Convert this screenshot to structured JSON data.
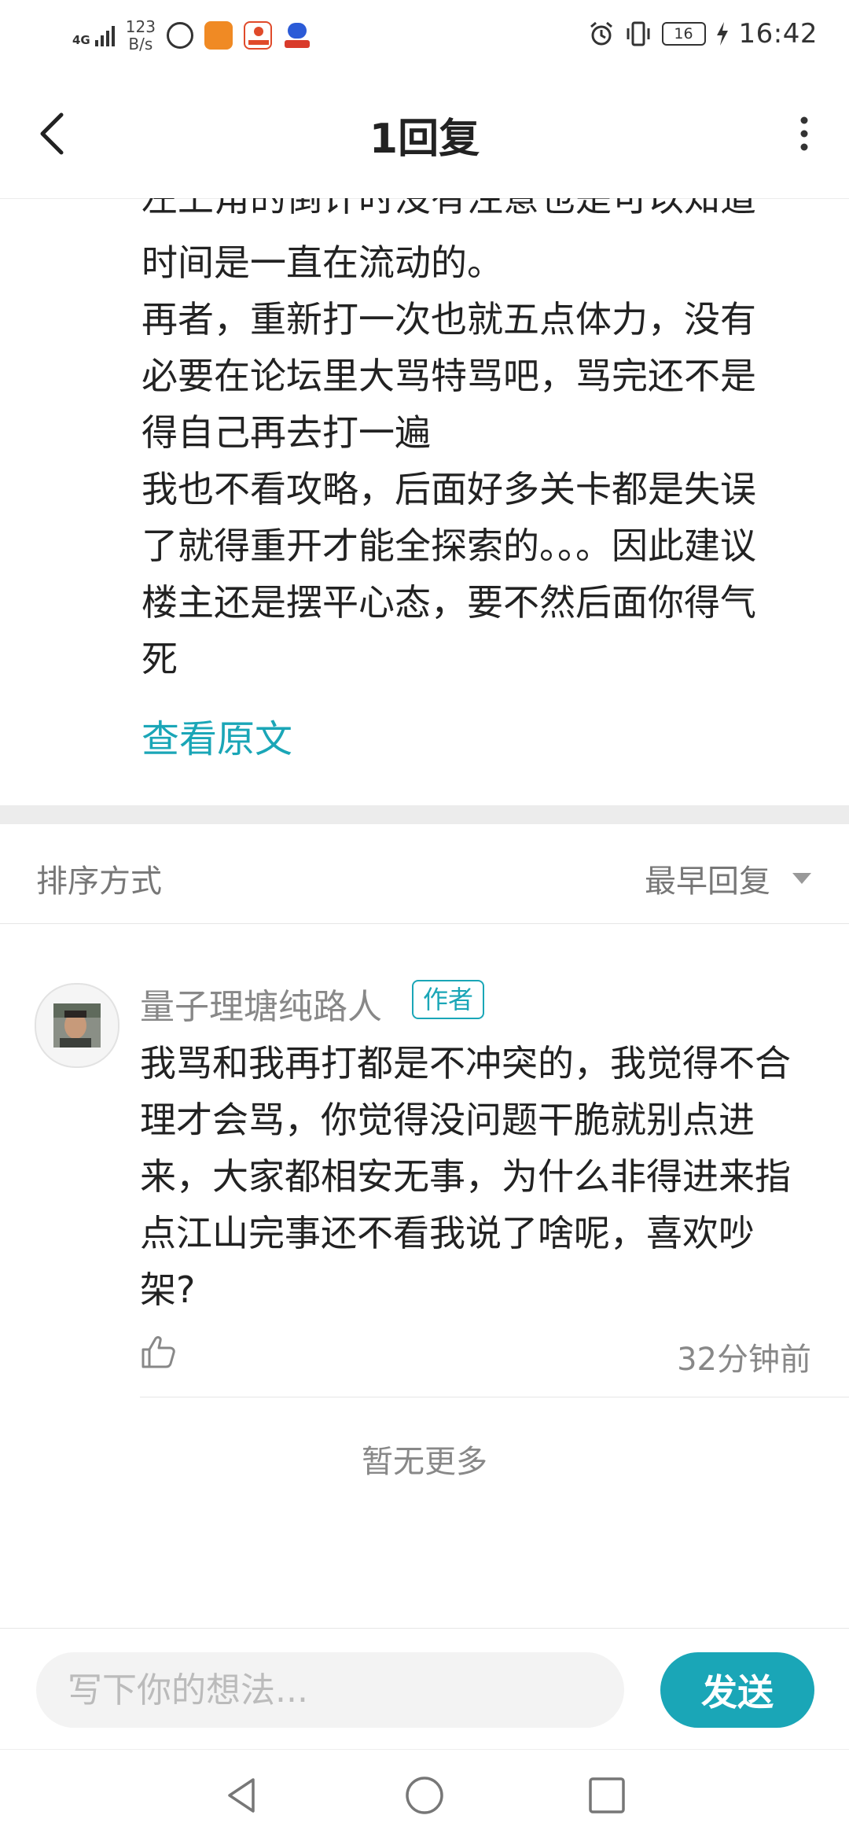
{
  "status_bar": {
    "network": "4G",
    "net_rate_value": "123",
    "net_rate_unit": "B/s",
    "battery": "16",
    "time": "16:42"
  },
  "header": {
    "title": "1回复"
  },
  "post": {
    "clipped_line": "左上角的倒计时没有注意也是可以知道",
    "paragraphs": [
      "时间是一直在流动的。",
      "再者，重新打一次也就五点体力，没有必要在论坛里大骂特骂吧，骂完还不是得自己再去打一遍",
      "我也不看攻略，后面好多关卡都是失误了就得重开才能全探索的。。。因此建议楼主还是摆平心态，要不然后面你得气死"
    ],
    "view_original": "查看原文"
  },
  "sort": {
    "label": "排序方式",
    "value": "最早回复"
  },
  "reply": {
    "username": "量子理塘纯路人",
    "badge": "作者",
    "text": "我骂和我再打都是不冲突的，我觉得不合理才会骂，你觉得没问题干脆就别点进来，大家都相安无事，为什么非得进来指点江山完事还不看我说了啥呢，喜欢吵架?",
    "time": "32分钟前"
  },
  "no_more": "暂无更多",
  "composer": {
    "placeholder": "写下你的想法...",
    "send_label": "发送"
  },
  "colors": {
    "accent": "#1aa6b7",
    "band": "#ececec",
    "muted_text": "#888888"
  }
}
